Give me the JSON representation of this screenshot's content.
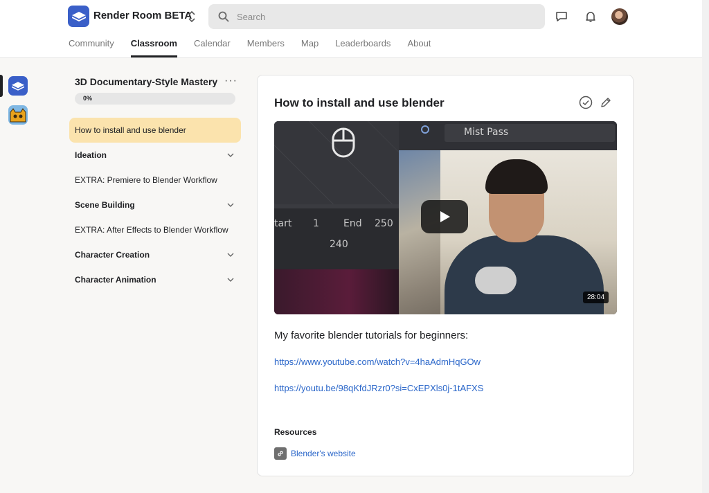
{
  "header": {
    "app_title": "Render Room BETA",
    "search_placeholder": "Search",
    "icons": [
      "chat-icon",
      "bell-icon",
      "avatar"
    ]
  },
  "nav": {
    "tabs": [
      {
        "label": "Community",
        "active": false
      },
      {
        "label": "Classroom",
        "active": true
      },
      {
        "label": "Calendar",
        "active": false
      },
      {
        "label": "Members",
        "active": false
      },
      {
        "label": "Map",
        "active": false
      },
      {
        "label": "Leaderboards",
        "active": false
      },
      {
        "label": "About",
        "active": false
      }
    ]
  },
  "course": {
    "title": "3D Documentary-Style Mastery",
    "progress_label": "0%",
    "progress": 0,
    "items": [
      {
        "label": "How to install and use blender",
        "type": "lesson",
        "active": true
      },
      {
        "label": "Ideation",
        "type": "section",
        "active": false
      },
      {
        "label": "EXTRA: Premiere to Blender Workflow",
        "type": "lesson",
        "active": false
      },
      {
        "label": "Scene Building",
        "type": "section",
        "active": false
      },
      {
        "label": "EXTRA: After Effects to Blender Workflow",
        "type": "lesson",
        "active": false
      },
      {
        "label": "Character Creation",
        "type": "section",
        "active": false
      },
      {
        "label": "Character Animation",
        "type": "section",
        "active": false
      }
    ]
  },
  "lesson": {
    "title": "How to install and use blender",
    "video": {
      "duration": "28:04",
      "overlay_panel": "Mist Pass",
      "overlay_start_label": "tart",
      "overlay_start_value": "1",
      "overlay_end_label": "End",
      "overlay_end_value": "250",
      "overlay_frame": "240"
    },
    "subheading": "My favorite blender tutorials for beginners:",
    "links": [
      "https://www.youtube.com/watch?v=4haAdmHqGOw",
      "https://youtu.be/98qKfdJRzr0?si=CxEPXls0j-1tAFXS"
    ],
    "resources_heading": "Resources",
    "resources": [
      {
        "label": "Blender's website",
        "icon": "link-icon"
      }
    ]
  },
  "colors": {
    "accent": "#3a5fc8",
    "active_lesson_bg": "#fbe3ad",
    "link": "#2a66c9"
  }
}
